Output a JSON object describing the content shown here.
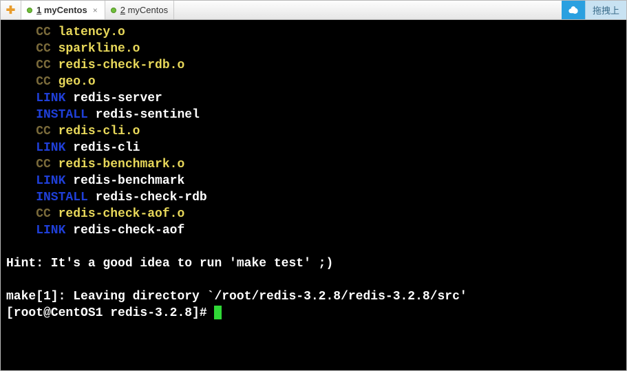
{
  "tabs": [
    {
      "num": "1",
      "label": "myCentos",
      "active": true
    },
    {
      "num": "2",
      "label": "myCentos",
      "active": false
    }
  ],
  "drag_text": "拖拽上",
  "terminal": {
    "lines": [
      {
        "tag": "CC",
        "tag_class": "c-cc",
        "target": "latency.o",
        "target_class": "c-yellow"
      },
      {
        "tag": "CC",
        "tag_class": "c-cc",
        "target": "sparkline.o",
        "target_class": "c-yellow"
      },
      {
        "tag": "CC",
        "tag_class": "c-cc",
        "target": "redis-check-rdb.o",
        "target_class": "c-yellow"
      },
      {
        "tag": "CC",
        "tag_class": "c-cc",
        "target": "geo.o",
        "target_class": "c-yellow"
      },
      {
        "tag": "LINK",
        "tag_class": "c-link",
        "target": "redis-server",
        "target_class": "c-white"
      },
      {
        "tag": "INSTALL",
        "tag_class": "c-install",
        "target": "redis-sentinel",
        "target_class": "c-white"
      },
      {
        "tag": "CC",
        "tag_class": "c-cc",
        "target": "redis-cli.o",
        "target_class": "c-yellow"
      },
      {
        "tag": "LINK",
        "tag_class": "c-link",
        "target": "redis-cli",
        "target_class": "c-white"
      },
      {
        "tag": "CC",
        "tag_class": "c-cc",
        "target": "redis-benchmark.o",
        "target_class": "c-yellow"
      },
      {
        "tag": "LINK",
        "tag_class": "c-link",
        "target": "redis-benchmark",
        "target_class": "c-white"
      },
      {
        "tag": "INSTALL",
        "tag_class": "c-install",
        "target": "redis-check-rdb",
        "target_class": "c-white"
      },
      {
        "tag": "CC",
        "tag_class": "c-cc",
        "target": "redis-check-aof.o",
        "target_class": "c-yellow"
      },
      {
        "tag": "LINK",
        "tag_class": "c-link",
        "target": "redis-check-aof",
        "target_class": "c-white"
      }
    ],
    "hint": "Hint: It's a good idea to run 'make test' ;)",
    "make_leave": "make[1]: Leaving directory `/root/redis-3.2.8/redis-3.2.8/src'",
    "prompt": "[root@CentOS1 redis-3.2.8]# "
  }
}
